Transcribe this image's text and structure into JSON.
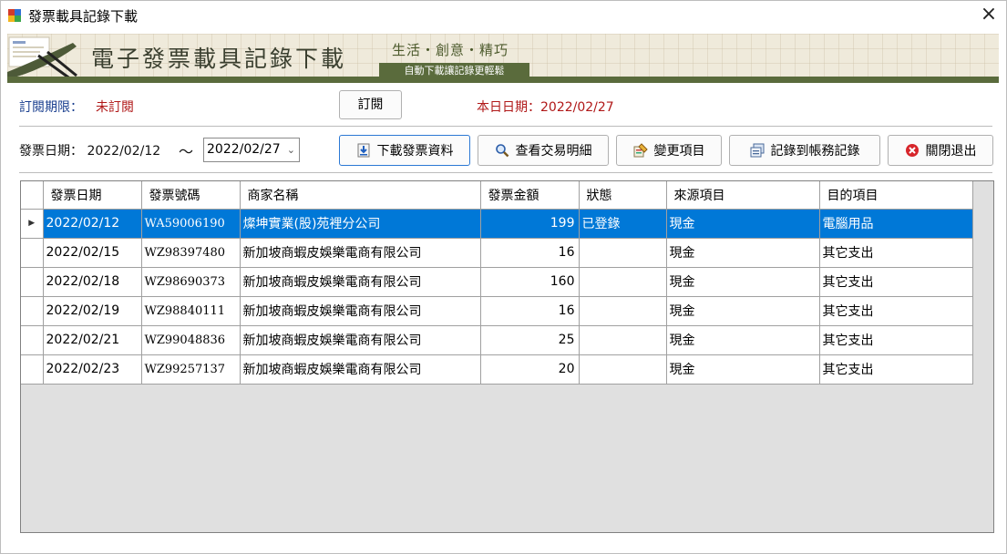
{
  "window": {
    "title": "發票載具記錄下載",
    "close_glyph": "×"
  },
  "banner": {
    "title": "電子發票載具記錄下載",
    "slogan": "生活・創意・精巧",
    "subtitle": "自動下載讓記錄更輕鬆"
  },
  "subscription": {
    "label": "訂閱期限：",
    "value": "未訂閱",
    "button": "訂閱"
  },
  "today": {
    "text": "本日日期：2022/02/27"
  },
  "filter": {
    "label": "發票日期：",
    "start": "2022/02/12",
    "separator": "～",
    "end": "2022/02/27"
  },
  "toolbar": {
    "download": "下載發票資料",
    "view_details": "查看交易明細",
    "change_items": "變更項目",
    "record_accounts": "記錄到帳務記錄",
    "close_exit": "關閉退出"
  },
  "grid": {
    "columns": [
      "發票日期",
      "發票號碼",
      "商家名稱",
      "發票金額",
      "狀態",
      "來源項目",
      "目的項目"
    ],
    "rows": [
      {
        "date": "2022/02/12",
        "number": "WA59006190",
        "merchant": "燦坤實業(股)苑裡分公司",
        "amount": "199",
        "status": "已登錄",
        "source": "現金",
        "target": "電腦用品",
        "selected": true
      },
      {
        "date": "2022/02/15",
        "number": "WZ98397480",
        "merchant": "新加坡商蝦皮娛樂電商有限公司",
        "amount": "16",
        "status": "",
        "source": "現金",
        "target": "其它支出"
      },
      {
        "date": "2022/02/18",
        "number": "WZ98690373",
        "merchant": "新加坡商蝦皮娛樂電商有限公司",
        "amount": "160",
        "status": "",
        "source": "現金",
        "target": "其它支出"
      },
      {
        "date": "2022/02/19",
        "number": "WZ98840111",
        "merchant": "新加坡商蝦皮娛樂電商有限公司",
        "amount": "16",
        "status": "",
        "source": "現金",
        "target": "其它支出"
      },
      {
        "date": "2022/02/21",
        "number": "WZ99048836",
        "merchant": "新加坡商蝦皮娛樂電商有限公司",
        "amount": "25",
        "status": "",
        "source": "現金",
        "target": "其它支出"
      },
      {
        "date": "2022/02/23",
        "number": "WZ99257137",
        "merchant": "新加坡商蝦皮娛樂電商有限公司",
        "amount": "20",
        "status": "",
        "source": "現金",
        "target": "其它支出"
      }
    ],
    "current_row_marker": "▶"
  },
  "colors": {
    "selection": "#0078d7",
    "label_blue": "#1a3f8f",
    "label_red": "#b01818",
    "banner_green": "#5a6b3c",
    "primary_border": "#2b78d4"
  },
  "icons": {
    "app": "app-icon",
    "download": "download-icon",
    "view_details": "magnifier-icon",
    "change_items": "edit-icon",
    "record_accounts": "ledger-icon",
    "close_exit": "close-circle-icon"
  }
}
